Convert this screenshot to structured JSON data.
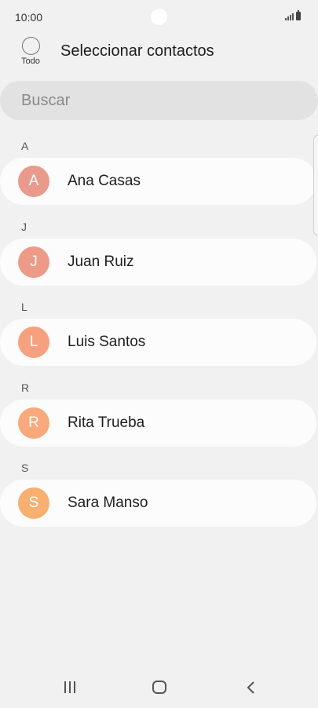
{
  "status_bar": {
    "time": "10:00"
  },
  "header": {
    "select_all_label": "Todo",
    "title": "Seleccionar contactos"
  },
  "search": {
    "placeholder": "Buscar"
  },
  "groups": [
    {
      "letter": "A",
      "contact": {
        "name": "Ana Casas",
        "initial": "A",
        "avatar_color": "#e99a8c"
      }
    },
    {
      "letter": "J",
      "contact": {
        "name": "Juan Ruiz",
        "initial": "J",
        "avatar_color": "#ee9a88"
      }
    },
    {
      "letter": "L",
      "contact": {
        "name": "Luis Santos",
        "initial": "L",
        "avatar_color": "#f7a07f"
      }
    },
    {
      "letter": "R",
      "contact": {
        "name": "Rita Trueba",
        "initial": "R",
        "avatar_color": "#f9a97c"
      }
    },
    {
      "letter": "S",
      "contact": {
        "name": "Sara Manso",
        "initial": "S",
        "avatar_color": "#f8b070"
      }
    }
  ],
  "nav": {
    "icons": [
      "recent-apps-icon",
      "home-icon",
      "back-icon"
    ]
  }
}
